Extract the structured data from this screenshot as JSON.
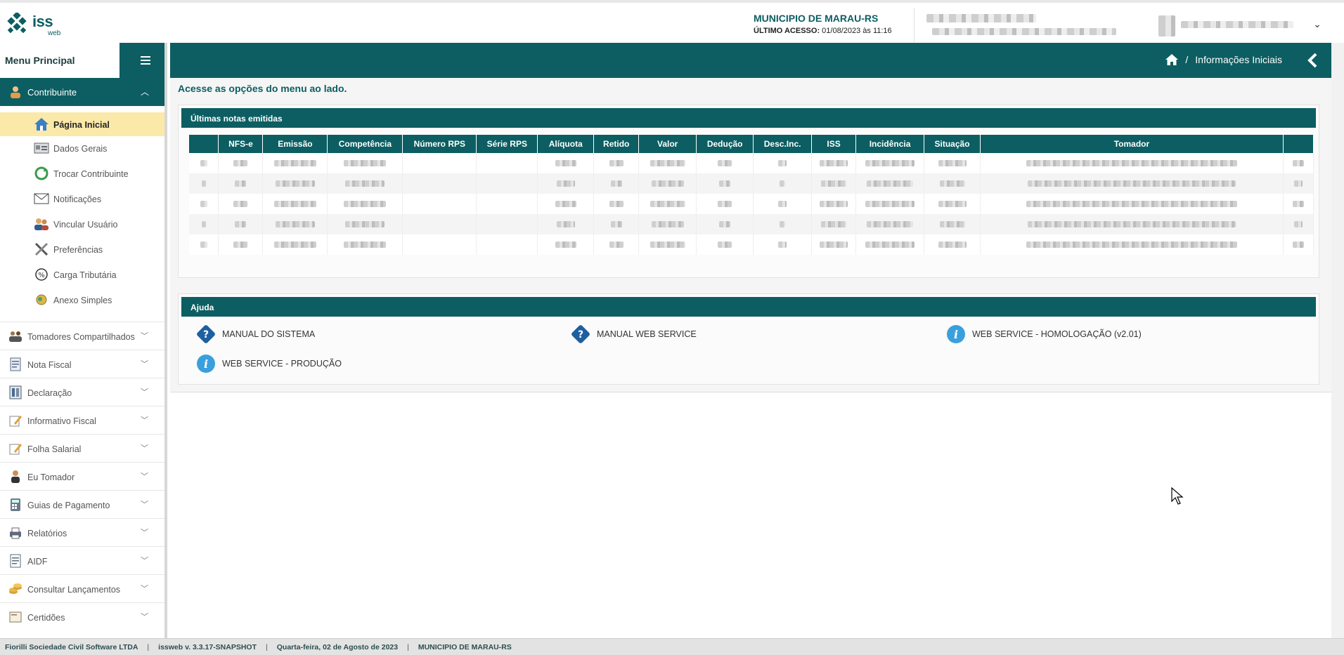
{
  "header": {
    "logo_text": "iss",
    "logo_sub": "web",
    "municipio": "MUNICIPIO DE MARAU-RS",
    "ultimo_acesso_label": "ÚLTIMO ACESSO:",
    "ultimo_acesso_value": "01/08/2023 às 11:16",
    "user_menu_icon": "chevron-down-icon"
  },
  "sidebar": {
    "title": "Menu Principal",
    "section": {
      "label": "Contribuinte",
      "icon": "user-icon"
    },
    "subitems": [
      {
        "label": "Página Inicial",
        "icon": "home-icon",
        "active": true
      },
      {
        "label": "Dados Gerais",
        "icon": "id-card-icon"
      },
      {
        "label": "Trocar Contribuinte",
        "icon": "refresh-icon"
      },
      {
        "label": "Notificações",
        "icon": "envelope-icon"
      },
      {
        "label": "Vincular Usuário",
        "icon": "users-icon"
      },
      {
        "label": "Preferências",
        "icon": "tools-icon"
      },
      {
        "label": "Carga Tributária",
        "icon": "percent-icon"
      },
      {
        "label": "Anexo Simples",
        "icon": "coin-icon"
      }
    ],
    "items": [
      {
        "label": "Tomadores Compartilhados",
        "icon": "group-icon"
      },
      {
        "label": "Nota Fiscal",
        "icon": "document-icon"
      },
      {
        "label": "Declaração",
        "icon": "ledger-icon"
      },
      {
        "label": "Informativo Fiscal",
        "icon": "pencil-icon"
      },
      {
        "label": "Folha Salarial",
        "icon": "pencil-icon"
      },
      {
        "label": "Eu Tomador",
        "icon": "person-icon"
      },
      {
        "label": "Guias de Pagamento",
        "icon": "calculator-icon"
      },
      {
        "label": "Relatórios",
        "icon": "printer-icon"
      },
      {
        "label": "AIDF",
        "icon": "document-icon"
      },
      {
        "label": "Consultar Lançamentos",
        "icon": "coins-icon"
      },
      {
        "label": "Certidões",
        "icon": "certificate-icon"
      }
    ]
  },
  "topbar": {
    "breadcrumb_sep": "/",
    "breadcrumb": "Informações Iniciais"
  },
  "main": {
    "hint": "Acesse as opções do menu ao lado.",
    "notas": {
      "title": "Últimas notas emitidas",
      "columns": [
        "",
        "NFS-e",
        "Emissão",
        "Competência",
        "Número RPS",
        "Série RPS",
        "Alíquota",
        "Retido",
        "Valor",
        "Dedução",
        "Desc.Inc.",
        "ISS",
        "Incidência",
        "Situação",
        "Tomador",
        ""
      ]
    },
    "ajuda": {
      "title": "Ajuda",
      "links": [
        {
          "label": "MANUAL DO SISTEMA",
          "icon": "manual-icon"
        },
        {
          "label": "MANUAL WEB SERVICE",
          "icon": "manual-icon"
        },
        {
          "label": "WEB SERVICE - HOMOLOGAÇÃO (v2.01)",
          "icon": "info-icon"
        },
        {
          "label": "WEB SERVICE - PRODUÇÃO",
          "icon": "info-icon"
        }
      ]
    }
  },
  "footer": {
    "company": "Fiorilli Sociedade Civil Software LTDA",
    "version": "issweb v. 3.3.17-SNAPSHOT",
    "date": "Quarta-feira, 02 de Agosto de 2023",
    "municipio": "MUNICIPIO DE MARAU-RS",
    "sep": "|"
  },
  "colors": {
    "primary": "#0c5e62",
    "active_bg": "#fbe9a9",
    "footer_bg": "#e3e3e3"
  }
}
